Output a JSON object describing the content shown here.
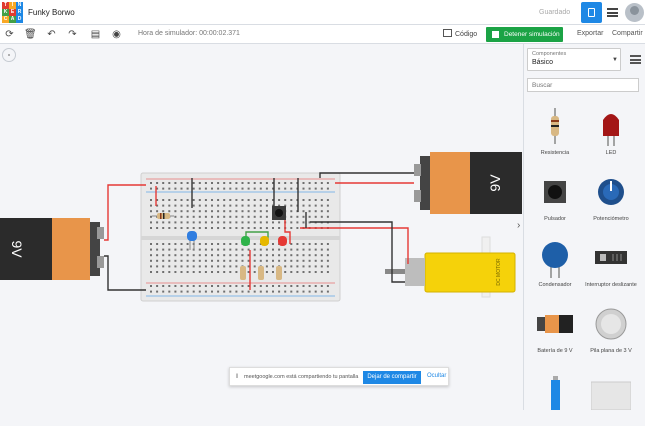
{
  "app": {
    "design_name": "Funky Borwo",
    "logo_letters": [
      "T",
      "I",
      "N",
      "K",
      "E",
      "R",
      "C",
      "A",
      "D"
    ],
    "logo_colors": [
      "#e03a2f",
      "#f9a825",
      "#1e88e5",
      "#43a047",
      "#e03a2f",
      "#1e88e5",
      "#f9a825",
      "#43a047",
      "#1e88e5"
    ]
  },
  "topbar": {
    "saved_label": "Guardado"
  },
  "toolbar": {
    "sim_time": "Hora de simulador: 00:00:02.371",
    "code_label": "Código",
    "stop_label": "Detener simulación",
    "export_label": "Exportar",
    "share_label": "Compartir"
  },
  "sidebar": {
    "components_label": "Componentes",
    "components_value": "Básico",
    "search_placeholder": "Buscar",
    "items": [
      {
        "label": "Resistencia",
        "icon": "resistor-icon"
      },
      {
        "label": "LED",
        "icon": "led-icon"
      },
      {
        "label": "Pulsador",
        "icon": "pushbutton-icon"
      },
      {
        "label": "Potenciómetro",
        "icon": "potentiometer-icon"
      },
      {
        "label": "Condensador",
        "icon": "capacitor-icon"
      },
      {
        "label": "Interruptor deslizante",
        "icon": "slide-switch-icon"
      },
      {
        "label": "Batería de 9 V",
        "icon": "battery-9v-icon"
      },
      {
        "label": "Pila plana de 3 V",
        "icon": "coin-cell-icon"
      }
    ]
  },
  "canvas": {
    "battery_left_label": "9V",
    "battery_right_label": "9V",
    "motor_label": "DC MOTOR"
  },
  "banner": {
    "message": "meetgoogle.com está compartiendo tu pantalla",
    "stop_label": "Dejar de compartir",
    "hide_label": "Ocultar"
  },
  "colors": {
    "accent_blue": "#1e88e5",
    "stop_green": "#1ba345",
    "wire_red": "#e53935",
    "wire_black": "#333333",
    "wire_green": "#43a047",
    "battery_orange": "#e8954a"
  }
}
